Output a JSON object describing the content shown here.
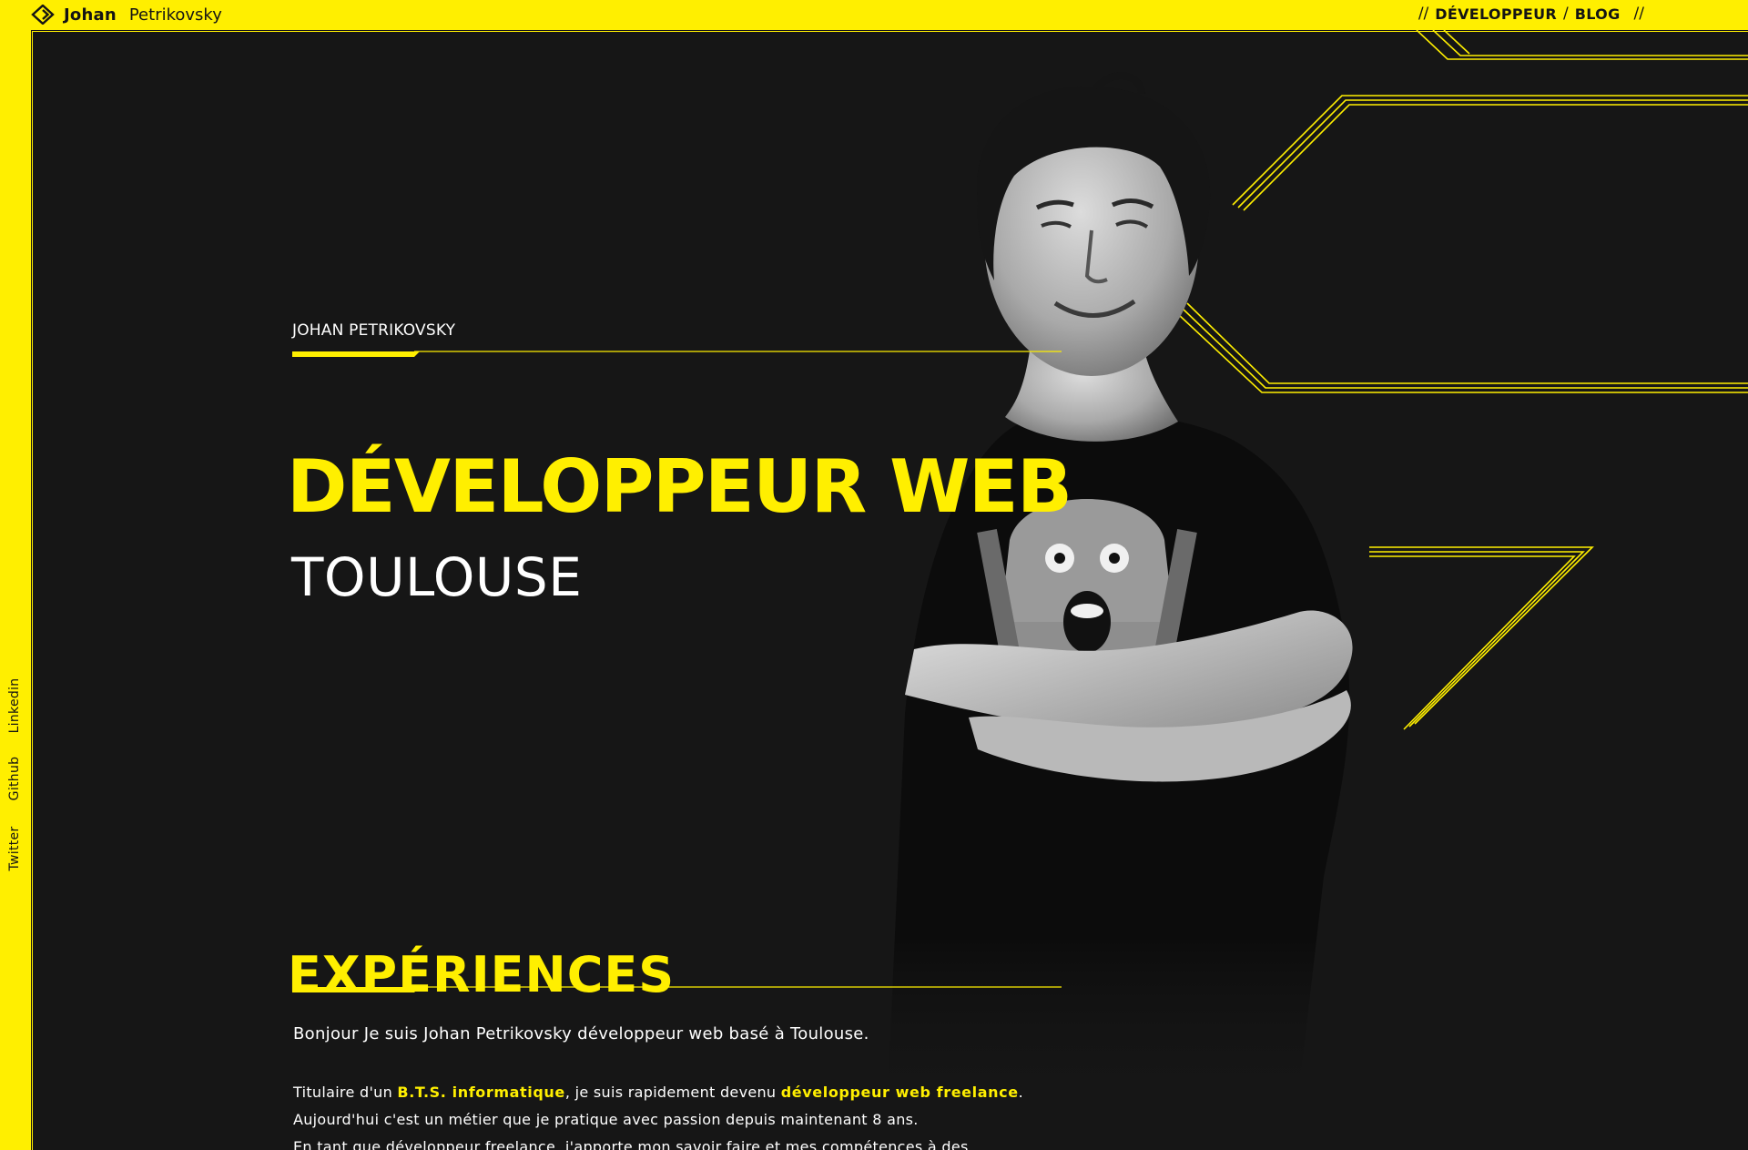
{
  "brand": {
    "first_name": "Johan",
    "last_name": "Petrikovsky"
  },
  "nav": {
    "sep_open": "//",
    "items": [
      {
        "label": "DÉVELOPPEUR"
      },
      {
        "label": "BLOG"
      }
    ],
    "sep_mid": "/",
    "sep_close": "//"
  },
  "social": {
    "items": [
      {
        "label": "Linkedin"
      },
      {
        "label": "Github"
      },
      {
        "label": "Twitter"
      }
    ]
  },
  "hero": {
    "overline": "JOHAN PETRIKOVSKY",
    "headline": "DÉVELOPPEUR WEB",
    "subline": "TOULOUSE"
  },
  "experiences": {
    "title": "EXPÉRIENCES",
    "intro": "Bonjour  Je suis Johan Petrikovsky développeur web basé à Toulouse.",
    "p1_a": "Titulaire d'un ",
    "p1_hl1": "B.T.S. informatique",
    "p1_b": ", je suis rapidement devenu ",
    "p1_hl2": "développeur web freelance",
    "p1_c": ".",
    "p2": "Aujourd'hui c'est un métier que je pratique avec passion depuis maintenant 8 ans.",
    "p3": "En tant que développeur freelance, j'apporte mon savoir faire et mes compétences à des"
  },
  "colors": {
    "accent": "#FFEF00",
    "background": "#161616",
    "text": "#FFFFFF"
  },
  "icons": {
    "brand_logo": "diamond-logo-icon"
  }
}
